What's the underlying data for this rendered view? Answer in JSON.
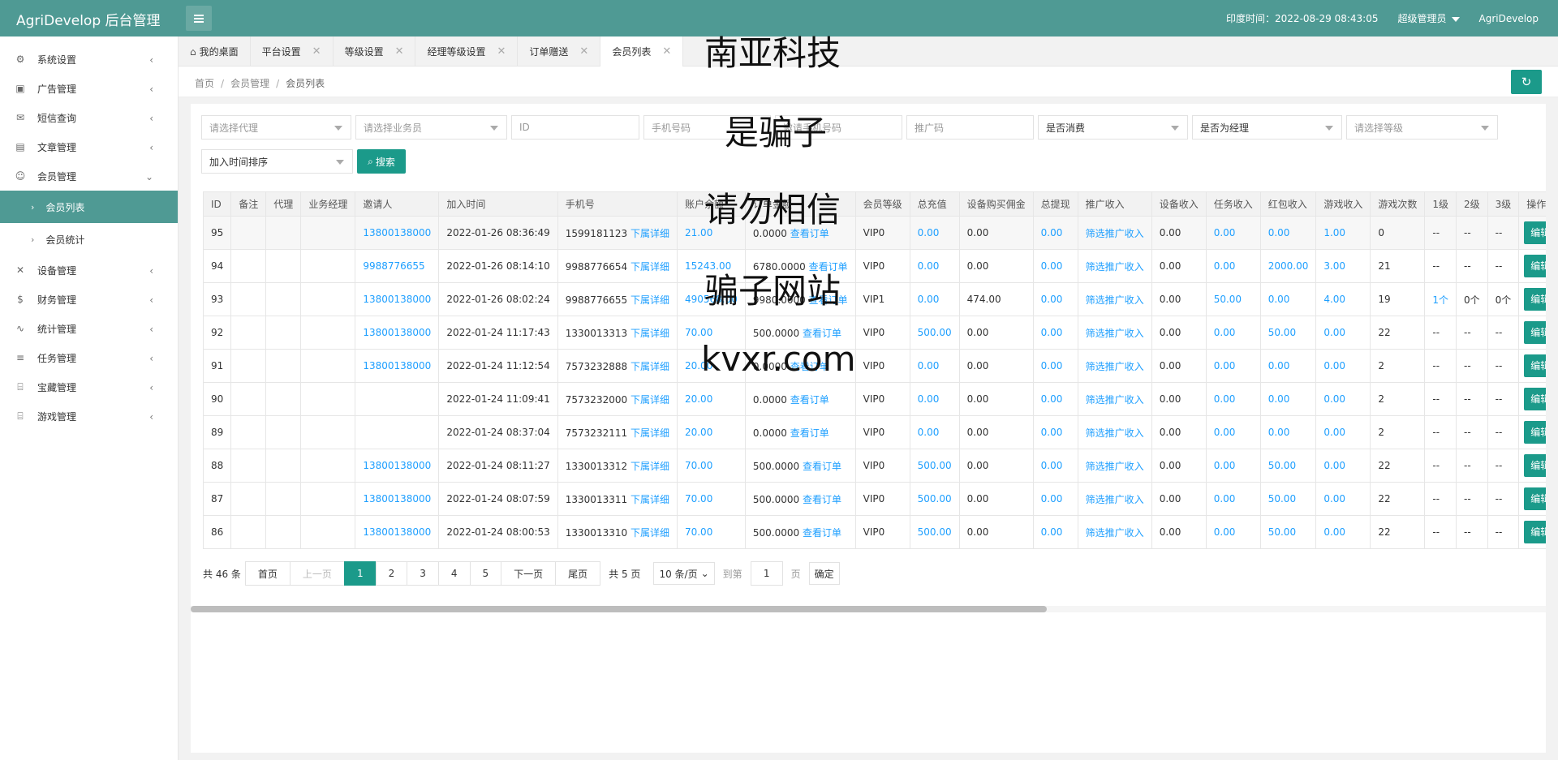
{
  "header": {
    "brand": "AgriDevelop 后台管理",
    "time_text": "印度时间：2022-08-29 08:43:05",
    "user_role": "超级管理员",
    "user_name": "AgriDevelop"
  },
  "sidebar": {
    "items": [
      {
        "label": "系统设置",
        "icon": "gear-icon"
      },
      {
        "label": "广告管理",
        "icon": "image-icon"
      },
      {
        "label": "短信查询",
        "icon": "mail-icon"
      },
      {
        "label": "文章管理",
        "icon": "book-icon"
      },
      {
        "label": "会员管理",
        "icon": "users-icon"
      },
      {
        "label": "设备管理",
        "icon": "tools-icon"
      },
      {
        "label": "财务管理",
        "icon": "dollar-icon"
      },
      {
        "label": "统计管理",
        "icon": "pulse-icon"
      },
      {
        "label": "任务管理",
        "icon": "sliders-icon"
      },
      {
        "label": "宝藏管理",
        "icon": "gift-icon"
      },
      {
        "label": "游戏管理",
        "icon": "gift-icon"
      }
    ],
    "sub_items": [
      "会员列表",
      "会员统计"
    ]
  },
  "tabs": [
    "我的桌面",
    "平台设置",
    "等级设置",
    "经理等级设置",
    "订单赠送",
    "会员列表"
  ],
  "breadcrumb": [
    "首页",
    "会员管理",
    "会员列表"
  ],
  "filters": {
    "agent": "请选择代理",
    "salesman": "请选择业务员",
    "id": "ID",
    "phone": "手机号码",
    "invite_phone": "邀请手机号码",
    "promo_code": "推广码",
    "consumed": "是否消费",
    "is_manager": "是否为经理",
    "level": "请选择等级",
    "sort": "加入时间排序",
    "search_label": "搜索"
  },
  "table": {
    "headers": [
      "ID",
      "备注",
      "代理",
      "业务经理",
      "邀请人",
      "加入时间",
      "手机号",
      "账户余额",
      "订单金额",
      "会员等级",
      "总充值",
      "设备购买佣金",
      "总提现",
      "推广收入",
      "设备收入",
      "任务收入",
      "红包收入",
      "游戏收入",
      "游戏次数",
      "1级",
      "2级",
      "3级",
      "操作"
    ],
    "sub_link": "下属详细",
    "order_link": "查看订单",
    "promo_link": "筛选推广收入",
    "edit_label": "编辑",
    "rows": [
      {
        "id": "95",
        "inviter": "13800138000",
        "time": "2022-01-26 08:36:49",
        "phone": "1599181123",
        "balance": "21.00",
        "order": "0.0000",
        "level": "VIP0",
        "recharge": "0.00",
        "commission": "0.00",
        "withdraw": "0.00",
        "device": "0.00",
        "task": "0.00",
        "redpack": "0.00",
        "game": "1.00",
        "plays": "0",
        "l1": "--",
        "l2": "--",
        "l3": "--"
      },
      {
        "id": "94",
        "inviter": "9988776655",
        "time": "2022-01-26 08:14:10",
        "phone": "9988776654",
        "balance": "15243.00",
        "order": "6780.0000",
        "level": "VIP0",
        "recharge": "0.00",
        "commission": "0.00",
        "withdraw": "0.00",
        "device": "0.00",
        "task": "0.00",
        "redpack": "2000.00",
        "game": "3.00",
        "plays": "21",
        "l1": "--",
        "l2": "--",
        "l3": "--"
      },
      {
        "id": "93",
        "inviter": "13800138000",
        "time": "2022-01-26 08:02:24",
        "phone": "9988776655",
        "balance": "490568.00",
        "order": "9980.0000",
        "level": "VIP1",
        "recharge": "0.00",
        "commission": "474.00",
        "withdraw": "0.00",
        "device": "0.00",
        "task": "50.00",
        "redpack": "0.00",
        "game": "4.00",
        "plays": "19",
        "l1": "1个",
        "l2": "0个",
        "l3": "0个"
      },
      {
        "id": "92",
        "inviter": "13800138000",
        "time": "2022-01-24 11:17:43",
        "phone": "1330013313",
        "balance": "70.00",
        "order": "500.0000",
        "level": "VIP0",
        "recharge": "500.00",
        "commission": "0.00",
        "withdraw": "0.00",
        "device": "0.00",
        "task": "0.00",
        "redpack": "50.00",
        "game": "0.00",
        "plays": "22",
        "l1": "--",
        "l2": "--",
        "l3": "--"
      },
      {
        "id": "91",
        "inviter": "13800138000",
        "time": "2022-01-24 11:12:54",
        "phone": "7573232888",
        "balance": "20.00",
        "order": "0.0000",
        "level": "VIP0",
        "recharge": "0.00",
        "commission": "0.00",
        "withdraw": "0.00",
        "device": "0.00",
        "task": "0.00",
        "redpack": "0.00",
        "game": "0.00",
        "plays": "2",
        "l1": "--",
        "l2": "--",
        "l3": "--"
      },
      {
        "id": "90",
        "inviter": "",
        "time": "2022-01-24 11:09:41",
        "phone": "7573232000",
        "balance": "20.00",
        "order": "0.0000",
        "level": "VIP0",
        "recharge": "0.00",
        "commission": "0.00",
        "withdraw": "0.00",
        "device": "0.00",
        "task": "0.00",
        "redpack": "0.00",
        "game": "0.00",
        "plays": "2",
        "l1": "--",
        "l2": "--",
        "l3": "--"
      },
      {
        "id": "89",
        "inviter": "",
        "time": "2022-01-24 08:37:04",
        "phone": "7573232111",
        "balance": "20.00",
        "order": "0.0000",
        "level": "VIP0",
        "recharge": "0.00",
        "commission": "0.00",
        "withdraw": "0.00",
        "device": "0.00",
        "task": "0.00",
        "redpack": "0.00",
        "game": "0.00",
        "plays": "2",
        "l1": "--",
        "l2": "--",
        "l3": "--"
      },
      {
        "id": "88",
        "inviter": "13800138000",
        "time": "2022-01-24 08:11:27",
        "phone": "1330013312",
        "balance": "70.00",
        "order": "500.0000",
        "level": "VIP0",
        "recharge": "500.00",
        "commission": "0.00",
        "withdraw": "0.00",
        "device": "0.00",
        "task": "0.00",
        "redpack": "50.00",
        "game": "0.00",
        "plays": "22",
        "l1": "--",
        "l2": "--",
        "l3": "--"
      },
      {
        "id": "87",
        "inviter": "13800138000",
        "time": "2022-01-24 08:07:59",
        "phone": "1330013311",
        "balance": "70.00",
        "order": "500.0000",
        "level": "VIP0",
        "recharge": "500.00",
        "commission": "0.00",
        "withdraw": "0.00",
        "device": "0.00",
        "task": "0.00",
        "redpack": "50.00",
        "game": "0.00",
        "plays": "22",
        "l1": "--",
        "l2": "--",
        "l3": "--"
      },
      {
        "id": "86",
        "inviter": "13800138000",
        "time": "2022-01-24 08:00:53",
        "phone": "1330013310",
        "balance": "70.00",
        "order": "500.0000",
        "level": "VIP0",
        "recharge": "500.00",
        "commission": "0.00",
        "withdraw": "0.00",
        "device": "0.00",
        "task": "0.00",
        "redpack": "50.00",
        "game": "0.00",
        "plays": "22",
        "l1": "--",
        "l2": "--",
        "l3": "--"
      }
    ]
  },
  "pager": {
    "total": "共 46 条",
    "first": "首页",
    "prev": "上一页",
    "pages": [
      "1",
      "2",
      "3",
      "4",
      "5"
    ],
    "next": "下一页",
    "last": "尾页",
    "page_count": "共 5 页",
    "per_page": "10 条/页",
    "goto": "到第",
    "goto_value": "1",
    "page_unit": "页",
    "confirm": "确定"
  },
  "overlay": [
    "南亚科技",
    "是骗子",
    "请勿相信",
    "骗子网站",
    "kvxr.com"
  ],
  "colors": {
    "header": "#4f9a94",
    "accent": "#1b9a8a",
    "link": "#1e9fff"
  }
}
